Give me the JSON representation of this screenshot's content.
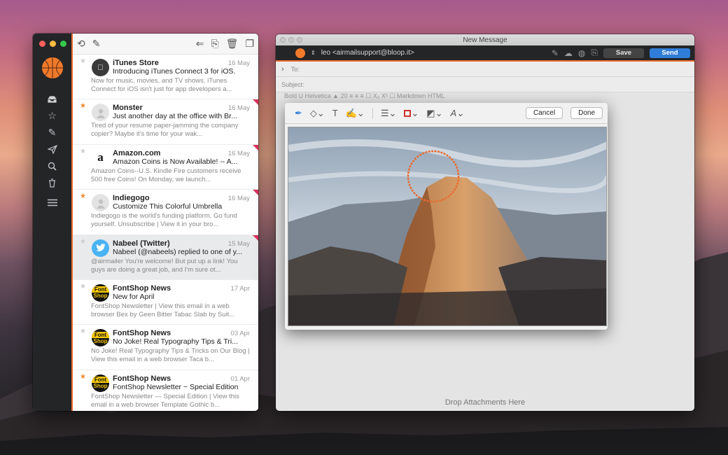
{
  "mail_window": {
    "toolbar_icons": [
      "retweet-icon",
      "compose-icon",
      "reply-icon",
      "archive-icon",
      "trash-icon",
      "move-icon"
    ],
    "sidebar_icons": [
      "inbox-icon",
      "star-icon",
      "pencil-icon",
      "send-icon",
      "search-icon",
      "trash-icon",
      "menu-icon"
    ],
    "messages": [
      {
        "from": "iTunes Store",
        "date": "16 May",
        "subject": "Introducing iTunes Connect 3 for iOS.",
        "preview": "Now for music, movies, and TV shows. iTunes Connect for iOS isn't just for app developers a...",
        "starred": false,
        "flag": false,
        "avatar": "apple"
      },
      {
        "from": "Monster",
        "date": "16 May",
        "subject": "Just another day at the office with Br...",
        "preview": "Tired of your resume paper-jamming the company copier? Maybe it's time for your wak...",
        "starred": true,
        "flag": true,
        "avatar": "person"
      },
      {
        "from": "Amazon.com",
        "date": "16 May",
        "subject": "Amazon Coins is Now Available! -- A...",
        "preview": "Amazon Coins--U.S. Kindle Fire customers receive 500 free Coins! On Monday, we launch...",
        "starred": false,
        "flag": true,
        "avatar": "amazon"
      },
      {
        "from": "Indiegogo",
        "date": "16 May",
        "subject": "Customize This Colorful Umbrella",
        "preview": "Indiegogo is the world's funding platform. Go fund yourself. Unsubscribe | View it in your bro...",
        "starred": true,
        "flag": true,
        "avatar": "person"
      },
      {
        "from": "Nabeel (Twitter)",
        "date": "15 May",
        "subject": "Nabeel (@nabeels) replied to one of y...",
        "preview": "@airmailer You're welcome! But put up a link! You guys are doing a great job, and I'm sure ot...",
        "starred": false,
        "flag": true,
        "avatar": "twitter",
        "selected": true
      },
      {
        "from": "FontShop News",
        "date": "17 Apr",
        "subject": "New for April",
        "preview": "FontShop Newsletter | View this email in a web browser Bex by Geen Bitter Tabac Slab by Suit...",
        "starred": false,
        "flag": false,
        "avatar": "fontshop"
      },
      {
        "from": "FontShop News",
        "date": "03 Apr",
        "subject": "No Joke! Real Typography Tips & Tri...",
        "preview": "No Joke! Real Typography Tips & Tricks on Our Blog | View this email in a web browser Taca b...",
        "starred": false,
        "flag": false,
        "avatar": "fontshop"
      },
      {
        "from": "FontShop News",
        "date": "01 Apr",
        "subject": "FontShop Newsletter ~ Special Edition",
        "preview": "FontShop Newsletter — Special Edition | View this email in a web browser Template Gothic b...",
        "starred": true,
        "flag": false,
        "avatar": "fontshop"
      }
    ],
    "fontshop_top": "Font",
    "fontshop_bottom": "Shop"
  },
  "compose_window": {
    "title": "New Message",
    "sender": "leo <airmailsupport@bloop.it>",
    "save_label": "Save",
    "send_label": "Send",
    "to_label": "To:",
    "subject_label": "Subject:",
    "format_bar_text": "Bold  U  Helvetica  ▲ 20  ≡  ≡  ≡  ☐  X₂  X²  ☐  Markdown  HTML",
    "drop_text": "Drop Attachments Here"
  },
  "markup_dialog": {
    "cancel_label": "Cancel",
    "done_label": "Done",
    "tools": [
      "pen-icon",
      "shapes-icon",
      "text-icon",
      "signature-icon",
      "line-style-icon",
      "border-color-icon",
      "fill-color-icon",
      "font-icon"
    ],
    "accent": "#e96b2e"
  },
  "colors": {
    "accent": "#e96b2e",
    "send": "#2f7dd8",
    "sidebar": "#232526"
  }
}
